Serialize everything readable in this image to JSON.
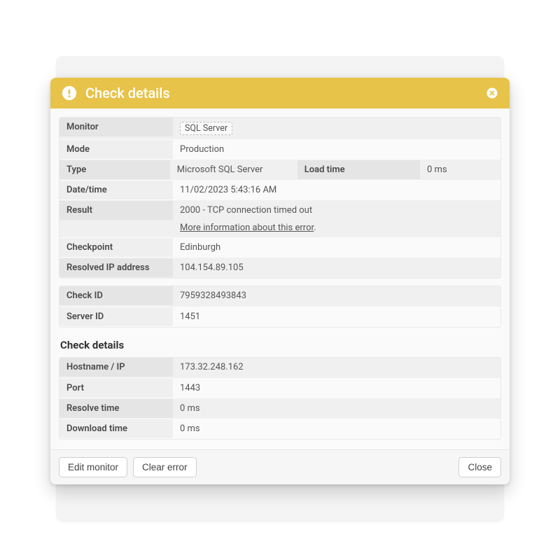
{
  "header": {
    "title": "Check details"
  },
  "section1": {
    "monitor_label": "Monitor",
    "monitor_value": "SQL Server",
    "mode_label": "Mode",
    "mode_value": "Production",
    "type_label": "Type",
    "type_value": "Microsoft SQL Server",
    "loadtime_label": "Load time",
    "loadtime_value": "0 ms",
    "datetime_label": "Date/time",
    "datetime_value": "11/02/2023 5:43:16 AM",
    "result_label": "Result",
    "result_value": "2000 - TCP connection timed out",
    "result_link": "More information about this error",
    "checkpoint_label": "Checkpoint",
    "checkpoint_value": "Edinburgh",
    "resolvedip_label": "Resolved IP address",
    "resolvedip_value": "104.154.89.105"
  },
  "section2": {
    "checkid_label": "Check ID",
    "checkid_value": "7959328493843",
    "serverid_label": "Server ID",
    "serverid_value": "1451"
  },
  "section3": {
    "title": "Check details",
    "hostname_label": "Hostname / IP",
    "hostname_value": "173.32.248.162",
    "port_label": "Port",
    "port_value": "1443",
    "resolvetime_label": "Resolve time",
    "resolvetime_value": "0 ms",
    "downloadtime_label": "Download time",
    "downloadtime_value": "0 ms"
  },
  "footer": {
    "edit_label": "Edit monitor",
    "clear_label": "Clear error",
    "close_label": "Close"
  }
}
